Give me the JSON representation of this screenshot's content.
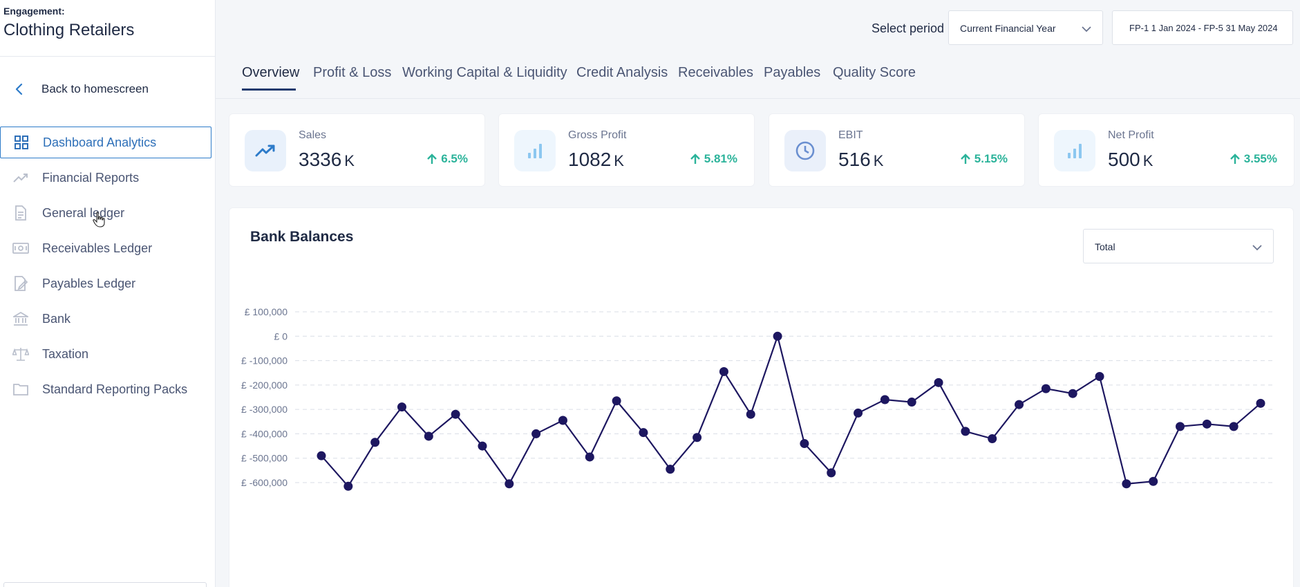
{
  "engagement": {
    "label": "Engagement:",
    "name": "Clothing Retailers"
  },
  "back": {
    "label": "Back to homescreen"
  },
  "sidebar": {
    "items": [
      {
        "label": "Dashboard Analytics",
        "icon": "grid-icon",
        "active": true
      },
      {
        "label": "Financial Reports",
        "icon": "trend-icon",
        "active": false
      },
      {
        "label": "General ledger",
        "icon": "document-icon",
        "active": false
      },
      {
        "label": "Receivables Ledger",
        "icon": "cash-icon",
        "active": false
      },
      {
        "label": "Payables Ledger",
        "icon": "edit-document-icon",
        "active": false
      },
      {
        "label": "Bank",
        "icon": "bank-icon",
        "active": false
      },
      {
        "label": "Taxation",
        "icon": "scales-icon",
        "active": false
      },
      {
        "label": "Standard Reporting Packs",
        "icon": "folder-icon",
        "active": false
      }
    ]
  },
  "period": {
    "label": "Select period",
    "selected": "Current Financial Year",
    "range": "FP-1 1 Jan 2024 - FP-5 31 May 2024"
  },
  "tabs": [
    {
      "label": "Overview",
      "active": true
    },
    {
      "label": "Profit & Loss",
      "active": false
    },
    {
      "label": "Working Capital & Liquidity",
      "active": false
    },
    {
      "label": "Credit Analysis",
      "active": false
    },
    {
      "label": "Receivables",
      "active": false
    },
    {
      "label": "Payables",
      "active": false
    },
    {
      "label": "Quality Score",
      "active": false
    }
  ],
  "kpis": [
    {
      "name": "Sales",
      "value": "3336",
      "unit": "K",
      "change": "6.5%",
      "icon": "trend-up-icon"
    },
    {
      "name": "Gross Profit",
      "value": "1082",
      "unit": "K",
      "change": "5.81%",
      "icon": "bar-chart-icon"
    },
    {
      "name": "EBIT",
      "value": "516",
      "unit": "K",
      "change": "5.15%",
      "icon": "clock-icon"
    },
    {
      "name": "Net Profit",
      "value": "500",
      "unit": "K",
      "change": "3.55%",
      "icon": "bar-chart-icon"
    }
  ],
  "colors": {
    "accent": "#2d7bc9",
    "positive": "#2bb39a",
    "line": "#1d1760",
    "text": "#1f2a44"
  },
  "chart_card": {
    "title": "Bank Balances",
    "select_value": "Total"
  },
  "chart_data": {
    "type": "line",
    "title": "Bank Balances",
    "ylabel": "",
    "xlabel": "",
    "yticks": [
      "£ 100,000",
      "£ 0",
      "£ -100,000",
      "£ -200,000",
      "£ -300,000",
      "£ -400,000",
      "£ -500,000",
      "£ -600,000"
    ],
    "ytick_values": [
      100000,
      0,
      -100000,
      -200000,
      -300000,
      -400000,
      -500000,
      -600000
    ],
    "ylim": [
      -600000,
      100000
    ],
    "grid": true,
    "series": [
      {
        "values": [
          -490000,
          -615000,
          -435000,
          -290000,
          -410000,
          -320000,
          -450000,
          -605000,
          -400000,
          -345000,
          -495000,
          -265000,
          -395000,
          -545000,
          -415000,
          -145000,
          -320000,
          0,
          -440000,
          -560000,
          -315000,
          -260000,
          -270000,
          -190000,
          -390000,
          -420000,
          -280000,
          -215000,
          -235000,
          -165000,
          -605000,
          -595000,
          -370000,
          -360000,
          -370000,
          -275000
        ]
      }
    ]
  }
}
